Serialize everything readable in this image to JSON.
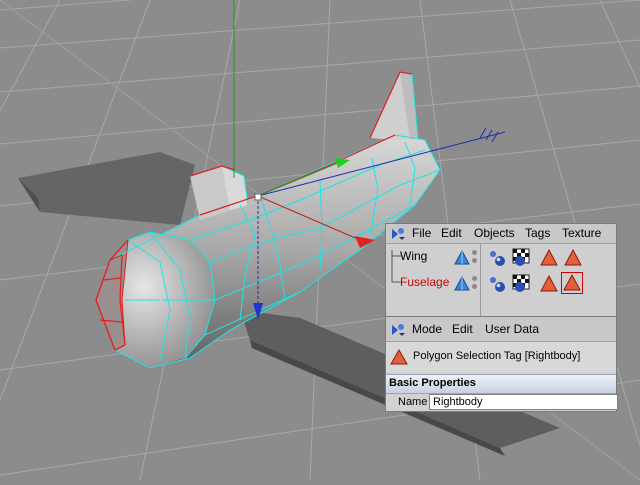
{
  "object_manager": {
    "menu": [
      "File",
      "Edit",
      "Objects",
      "Tags",
      "Texture"
    ],
    "objects": [
      {
        "name": "Wing",
        "selected": false
      },
      {
        "name": "Fuselage",
        "selected": true
      }
    ]
  },
  "attribute_manager": {
    "menu": [
      "Mode",
      "Edit",
      "User Data"
    ],
    "title": "Polygon Selection Tag [Rightbody]",
    "section": "Basic Properties",
    "name_label": "Name",
    "name_value": "Rightbody"
  },
  "colors": {
    "viewport_bg": "#8c8c8c",
    "grid": "#a6a6a6",
    "wireframe": "#19e6e6",
    "selection": "#e61e1e",
    "selected_text": "#d00000"
  }
}
